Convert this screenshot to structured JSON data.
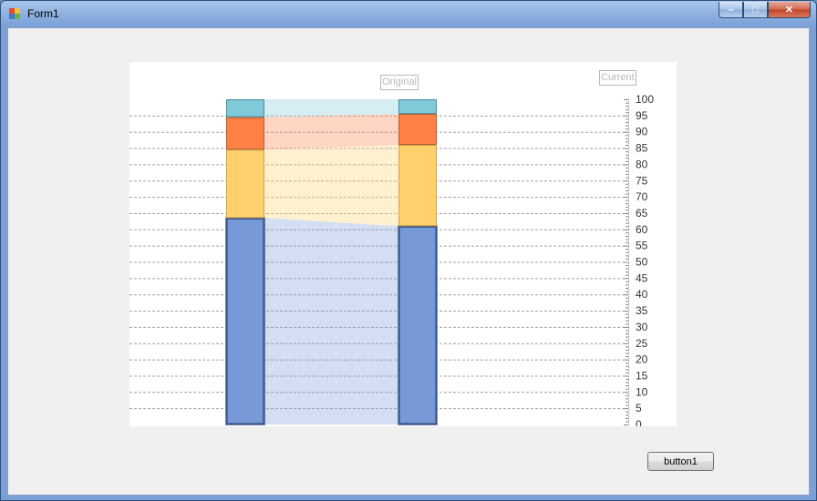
{
  "window": {
    "title": "Form1"
  },
  "title_buttons": {
    "minimize": "–",
    "maximize": "□",
    "close": "✕"
  },
  "buttons": {
    "button1": "button1"
  },
  "chart_data": {
    "type": "bar",
    "stacked": true,
    "categories": [
      "Original",
      "Current"
    ],
    "series": [
      {
        "values": [
          63.5,
          61
        ],
        "color": "#7899d8",
        "border": "#415a8c"
      },
      {
        "values": [
          21,
          25
        ],
        "color": "#ffd06b",
        "border": "#c9a451"
      },
      {
        "values": [
          10,
          9.5
        ],
        "color": "#ff8145",
        "border": "#b5592f"
      },
      {
        "values": [
          5.5,
          4.5
        ],
        "color": "#7fc9d9",
        "border": "#4d8e9c"
      }
    ],
    "ylim": [
      0,
      100
    ],
    "y_major_step": 5,
    "y_minor_step": 1,
    "y_axis_side": "right",
    "grid": "dashed",
    "legend": [
      "Original",
      "Current"
    ]
  }
}
